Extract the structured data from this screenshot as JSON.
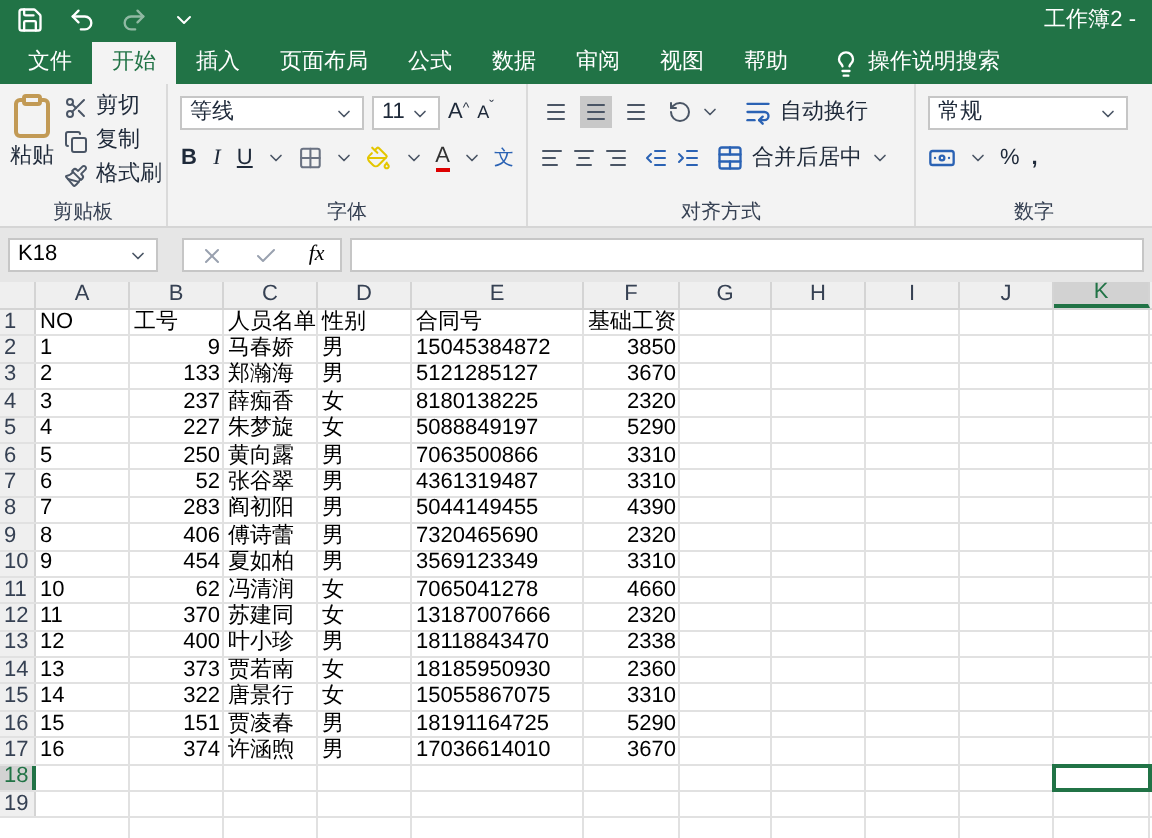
{
  "title_bar": {
    "title": "工作簿2 -"
  },
  "tabs": [
    {
      "label": "文件",
      "selected": false
    },
    {
      "label": "开始",
      "selected": true
    },
    {
      "label": "插入",
      "selected": false
    },
    {
      "label": "页面布局",
      "selected": false
    },
    {
      "label": "公式",
      "selected": false
    },
    {
      "label": "数据",
      "selected": false
    },
    {
      "label": "审阅",
      "selected": false
    },
    {
      "label": "视图",
      "selected": false
    },
    {
      "label": "帮助",
      "selected": false
    }
  ],
  "search": {
    "label": "操作说明搜索"
  },
  "ribbon": {
    "clipboard": {
      "label": "剪贴板",
      "paste": "粘贴",
      "items": [
        "剪切",
        "复制",
        "格式刷"
      ]
    },
    "font": {
      "label": "字体",
      "font_name": "等线",
      "font_size": "11",
      "grow": "A",
      "grow_mark": "^",
      "shrink": "A",
      "shrink_mark": "ˇ",
      "bold": "B",
      "italic": "I",
      "underline": "U",
      "font_color": "A",
      "phonetic": "文"
    },
    "alignment": {
      "label": "对齐方式",
      "vertical": [
        {
          "selected": false
        },
        {
          "selected": true
        },
        {
          "selected": false
        }
      ],
      "wrap": "自动换行",
      "merge": "合并后居中"
    },
    "number": {
      "label": "数字",
      "format": "常规",
      "percent": "%",
      "comma": ","
    }
  },
  "formula_bar": {
    "name_box": "K18",
    "function_label": "fx"
  },
  "sheet": {
    "columns": [
      {
        "label": "A",
        "kind": "text",
        "selected": false
      },
      {
        "label": "B",
        "kind": "number",
        "selected": false
      },
      {
        "label": "C",
        "kind": "text",
        "selected": false
      },
      {
        "label": "D",
        "kind": "text",
        "selected": false
      },
      {
        "label": "E",
        "kind": "text",
        "selected": false
      },
      {
        "label": "F",
        "kind": "number",
        "selected": false
      },
      {
        "label": "G",
        "kind": "text",
        "selected": false
      },
      {
        "label": "H",
        "kind": "text",
        "selected": false
      },
      {
        "label": "I",
        "kind": "text",
        "selected": false
      },
      {
        "label": "J",
        "kind": "text",
        "selected": false
      },
      {
        "label": "K",
        "kind": "text",
        "selected": true
      }
    ],
    "rows": [
      {
        "label": "1",
        "selected": false,
        "cells": [
          "NO",
          "工号",
          "人员名单",
          "性别",
          "合同号",
          "基础工资"
        ]
      },
      {
        "label": "2",
        "selected": false,
        "cells": [
          "1",
          "9",
          "马春娇",
          "男",
          "15045384872",
          "3850"
        ]
      },
      {
        "label": "3",
        "selected": false,
        "cells": [
          "2",
          "133",
          "郑瀚海",
          "男",
          "5121285127",
          "3670"
        ]
      },
      {
        "label": "4",
        "selected": false,
        "cells": [
          "3",
          "237",
          "薛痴香",
          "女",
          "8180138225",
          "2320"
        ]
      },
      {
        "label": "5",
        "selected": false,
        "cells": [
          "4",
          "227",
          "朱梦旋",
          "女",
          "5088849197",
          "5290"
        ]
      },
      {
        "label": "6",
        "selected": false,
        "cells": [
          "5",
          "250",
          "黄向露",
          "男",
          "7063500866",
          "3310"
        ]
      },
      {
        "label": "7",
        "selected": false,
        "cells": [
          "6",
          "52",
          "张谷翠",
          "男",
          "4361319487",
          "3310"
        ]
      },
      {
        "label": "8",
        "selected": false,
        "cells": [
          "7",
          "283",
          "阎初阳",
          "男",
          "5044149455",
          "4390"
        ]
      },
      {
        "label": "9",
        "selected": false,
        "cells": [
          "8",
          "406",
          "傅诗蕾",
          "男",
          "7320465690",
          "2320"
        ]
      },
      {
        "label": "10",
        "selected": false,
        "cells": [
          "9",
          "454",
          "夏如柏",
          "男",
          "3569123349",
          "3310"
        ]
      },
      {
        "label": "11",
        "selected": false,
        "cells": [
          "10",
          "62",
          "冯清润",
          "女",
          "7065041278",
          "4660"
        ]
      },
      {
        "label": "12",
        "selected": false,
        "cells": [
          "11",
          "370",
          "苏建同",
          "女",
          "13187007666",
          "2320"
        ]
      },
      {
        "label": "13",
        "selected": false,
        "cells": [
          "12",
          "400",
          "叶小珍",
          "男",
          "18118843470",
          "2338"
        ]
      },
      {
        "label": "14",
        "selected": false,
        "cells": [
          "13",
          "373",
          "贾若南",
          "女",
          "18185950930",
          "2360"
        ]
      },
      {
        "label": "15",
        "selected": false,
        "cells": [
          "14",
          "322",
          "唐景行",
          "女",
          "15055867075",
          "3310"
        ]
      },
      {
        "label": "16",
        "selected": false,
        "cells": [
          "15",
          "151",
          "贾凌春",
          "男",
          "18191164725",
          "5290"
        ]
      },
      {
        "label": "17",
        "selected": false,
        "cells": [
          "16",
          "374",
          "许涵煦",
          "男",
          "17036614010",
          "3670"
        ]
      },
      {
        "label": "18",
        "selected": true,
        "cells": []
      },
      {
        "label": "19",
        "selected": false,
        "cells": []
      }
    ]
  }
}
